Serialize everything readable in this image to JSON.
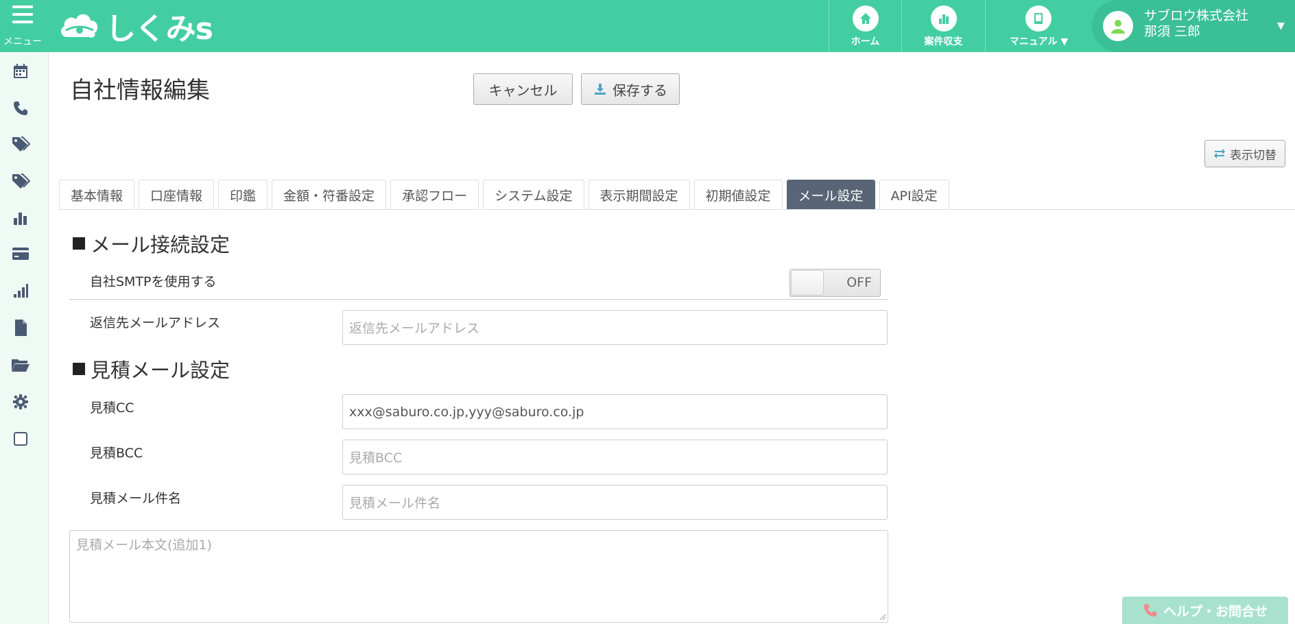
{
  "header": {
    "menu_label": "メニュー",
    "logo_text": "しくみs",
    "nav": [
      {
        "label": "ホーム",
        "icon": "home-icon"
      },
      {
        "label": "案件収支",
        "icon": "bar-chart-icon"
      },
      {
        "label": "マニュアル ▼",
        "icon": "book-icon"
      }
    ],
    "user": {
      "company": "サブロウ株式会社",
      "name": "那須 三郎"
    }
  },
  "sidebar": {
    "icons": [
      "calendar-icon",
      "phone-icon",
      "tag-icon",
      "tags-icon",
      "bar-chart-icon",
      "credit-card-icon",
      "signal-icon",
      "file-icon",
      "folder-open-icon",
      "gear-icon",
      "checkbox-icon"
    ]
  },
  "page": {
    "title": "自社情報編集",
    "cancel_label": "キャンセル",
    "save_label": "保存する",
    "toggle_view_label": "表示切替"
  },
  "tabs": [
    {
      "label": "基本情報",
      "active": false
    },
    {
      "label": "口座情報",
      "active": false
    },
    {
      "label": "印鑑",
      "active": false
    },
    {
      "label": "金額・符番設定",
      "active": false
    },
    {
      "label": "承認フロー",
      "active": false
    },
    {
      "label": "システム設定",
      "active": false
    },
    {
      "label": "表示期間設定",
      "active": false
    },
    {
      "label": "初期値設定",
      "active": false
    },
    {
      "label": "メール設定",
      "active": true
    },
    {
      "label": "API設定",
      "active": false
    }
  ],
  "mail_connection": {
    "title": "メール接続設定",
    "smtp_label": "自社SMTPを使用する",
    "smtp_state": "OFF",
    "reply_label": "返信先メールアドレス",
    "reply_placeholder": "返信先メールアドレス"
  },
  "estimate_mail": {
    "title": "見積メール設定",
    "cc_label": "見積CC",
    "cc_value": "xxx@saburo.co.jp,yyy@saburo.co.jp",
    "bcc_label": "見積BCC",
    "bcc_placeholder": "見積BCC",
    "subject_label": "見積メール件名",
    "subject_placeholder": "見積メール件名",
    "body_placeholder": "見積メール本文(追加1)"
  },
  "help": {
    "label": "ヘルプ・お問合せ"
  }
}
